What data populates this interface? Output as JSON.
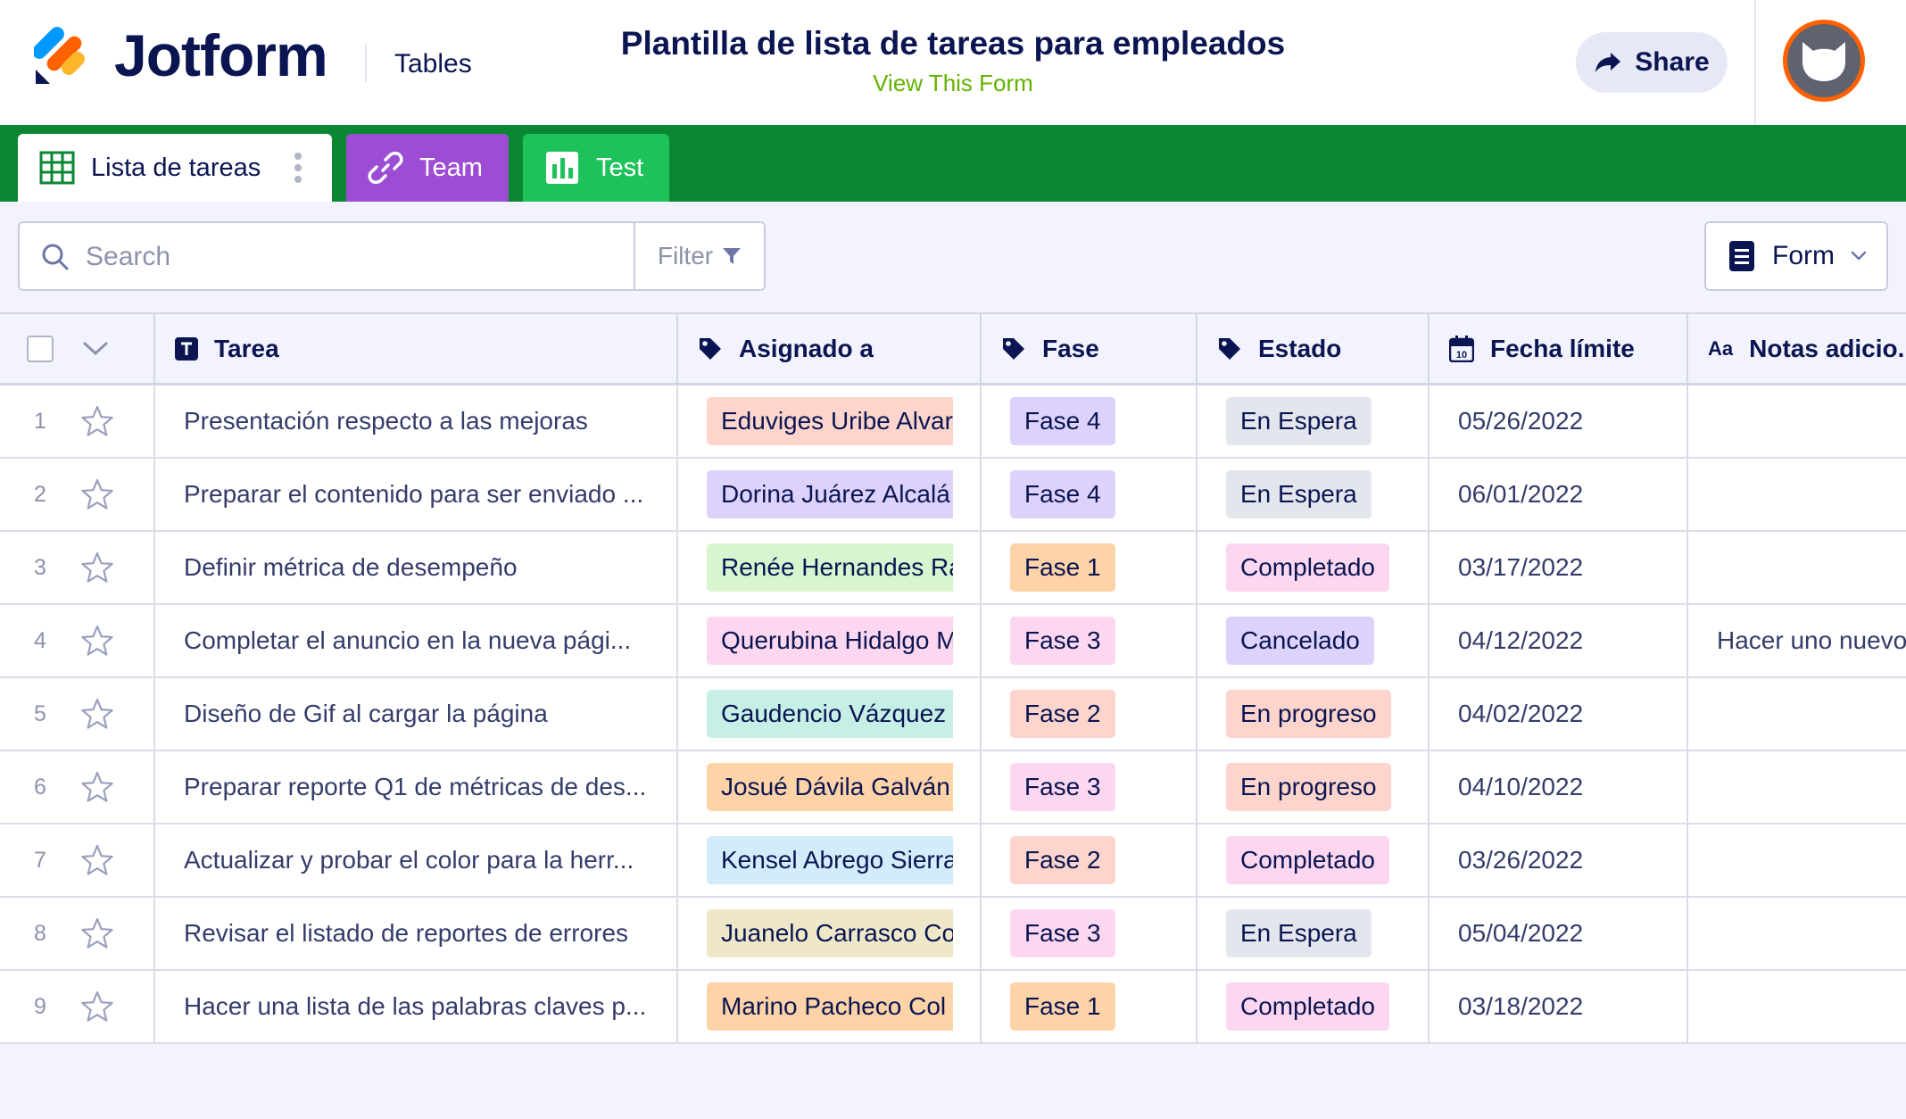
{
  "header": {
    "brand": "Jotform",
    "product": "Tables",
    "title": "Plantilla de lista de tareas para empleados",
    "view_form_link": "View This Form",
    "share_label": "Share"
  },
  "tabs": [
    {
      "label": "Lista de tareas",
      "icon": "grid-icon"
    },
    {
      "label": "Team",
      "icon": "link-icon"
    },
    {
      "label": "Test",
      "icon": "report-icon"
    }
  ],
  "toolbar": {
    "search_placeholder": "Search",
    "filter_label": "Filter",
    "form_label": "Form"
  },
  "columns": [
    {
      "label": "Tarea",
      "icon": "text-icon"
    },
    {
      "label": "Asignado a",
      "icon": "tag-icon"
    },
    {
      "label": "Fase",
      "icon": "tag-icon"
    },
    {
      "label": "Estado",
      "icon": "tag-icon"
    },
    {
      "label": "Fecha límite",
      "icon": "calendar-icon"
    },
    {
      "label": "Notas adicio...",
      "icon": "aa-icon"
    }
  ],
  "rows": [
    {
      "num": "1",
      "tarea": "Presentación respecto a las mejoras",
      "asignado": "Eduviges Uribe Alvar",
      "asignado_color": "#fdd5cc",
      "fase": "Fase 4",
      "fase_color": "#dcd2fb",
      "estado": "En Espera",
      "estado_color": "#e4e6ee",
      "fecha": "05/26/2022",
      "notas": ""
    },
    {
      "num": "2",
      "tarea": "Preparar el contenido para ser enviado ...",
      "asignado": "Dorina Juárez Alcalá",
      "asignado_color": "#dcd2fb",
      "fase": "Fase 4",
      "fase_color": "#dcd2fb",
      "estado": "En Espera",
      "estado_color": "#e4e6ee",
      "fecha": "06/01/2022",
      "notas": ""
    },
    {
      "num": "3",
      "tarea": "Definir métrica de desempeño",
      "asignado": "Renée Hernandes Ra",
      "asignado_color": "#d8f5cf",
      "fase": "Fase 1",
      "fase_color": "#ffd3a8",
      "estado": "Completado",
      "estado_color": "#fcd7ef",
      "fecha": "03/17/2022",
      "notas": ""
    },
    {
      "num": "4",
      "tarea": "Completar el anuncio en la nueva pági...",
      "asignado": "Querubina Hidalgo M",
      "asignado_color": "#fcd7ef",
      "fase": "Fase 3",
      "fase_color": "#fcd7ef",
      "estado": "Cancelado",
      "estado_color": "#dcd2fb",
      "fecha": "04/12/2022",
      "notas": "Hacer uno nuevo"
    },
    {
      "num": "5",
      "tarea": "Diseño de Gif al cargar la página",
      "asignado": "Gaudencio Vázquez T",
      "asignado_color": "#c6efe6",
      "fase": "Fase 2",
      "fase_color": "#fdd5cc",
      "estado": "En progreso",
      "estado_color": "#fdd5cc",
      "fecha": "04/02/2022",
      "notas": ""
    },
    {
      "num": "6",
      "tarea": "Preparar reporte Q1 de métricas de des...",
      "asignado": "Josué Dávila Galván",
      "asignado_color": "#ffd3a8",
      "fase": "Fase 3",
      "fase_color": "#fcd7ef",
      "estado": "En progreso",
      "estado_color": "#fdd5cc",
      "fecha": "04/10/2022",
      "notas": ""
    },
    {
      "num": "7",
      "tarea": "Actualizar y probar el color para la herr...",
      "asignado": "Kensel Abrego Sierra",
      "asignado_color": "#d3ecfb",
      "fase": "Fase 2",
      "fase_color": "#fdd5cc",
      "estado": "Completado",
      "estado_color": "#fcd7ef",
      "fecha": "03/26/2022",
      "notas": ""
    },
    {
      "num": "8",
      "tarea": "Revisar el listado de reportes de errores",
      "asignado": "Juanelo Carrasco Co",
      "asignado_color": "#eee8c8",
      "fase": "Fase 3",
      "fase_color": "#fcd7ef",
      "estado": "En Espera",
      "estado_color": "#e4e6ee",
      "fecha": "05/04/2022",
      "notas": ""
    },
    {
      "num": "9",
      "tarea": "Hacer una lista de las palabras claves p...",
      "asignado": "Marino Pacheco Col",
      "asignado_color": "#ffd3a8",
      "fase": "Fase 1",
      "fase_color": "#ffd3a8",
      "estado": "Completado",
      "estado_color": "#fcd7ef",
      "fecha": "03/18/2022",
      "notas": ""
    }
  ],
  "colors": {
    "navy": "#0a1551",
    "tab_bar_green": "#0b8734",
    "team_tab_purple": "#9c4dd3",
    "test_tab_green": "#1ec25a",
    "link_green": "#64b200",
    "avatar_orange": "#ff6100"
  }
}
